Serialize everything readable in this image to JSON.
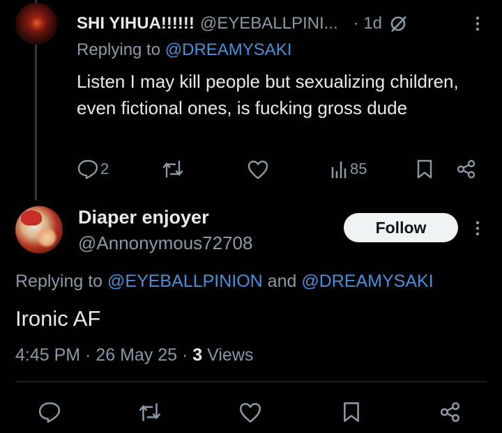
{
  "reply_tweet": {
    "display_name": "SHI YIHUA!!!!!!",
    "handle": "@EYEBALLPINI...",
    "time": "· 1d",
    "replying_prefix": "Replying to ",
    "replying_mention": "@DREAMYSAKI",
    "text": "Listen I may kill people but sexualizing children, even fictional ones, is fucking gross dude",
    "reply_count": "2",
    "views_count": "85"
  },
  "main_tweet": {
    "display_name": "Diaper enjoyer",
    "handle": "@Annonymous72708",
    "follow_label": "Follow",
    "replying_prefix": "Replying to ",
    "replying_mention_1": "@EYEBALLPINION",
    "replying_and": " and ",
    "replying_mention_2": "@DREAMYSAKI",
    "text": "Ironic AF",
    "timestamp": "4:45 PM · 26 May 25 · ",
    "views_count": "3",
    "views_label": " Views"
  },
  "colors": {
    "background": "#000000",
    "text_primary": "#e7e9ea",
    "text_secondary": "#8b98a5",
    "mention": "#4a90d9",
    "follow_bg": "#eff3f4"
  },
  "icons": [
    "reply-icon",
    "retweet-icon",
    "like-icon",
    "views-icon",
    "bookmark-icon",
    "share-icon",
    "grok-icon",
    "more-icon"
  ]
}
